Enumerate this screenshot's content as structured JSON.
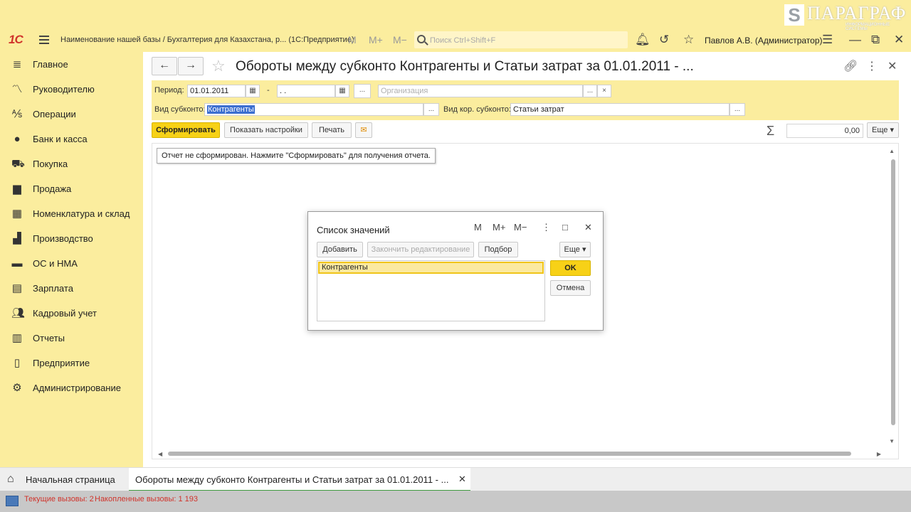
{
  "app": {
    "logo_text": "1С",
    "base_title": "Наименование нашей базы / Бухгалтерия для Казахстана, р...  (1С:Предприятие)",
    "mem_buttons": [
      "M",
      "M+",
      "M−"
    ],
    "search_placeholder": "Поиск Ctrl+Shift+F",
    "user": "Павлов А.В. (Администратор)",
    "brand_name": "ПАРАГРАФ",
    "brand_sub": "ИНФОРМАЦИОННЫЕ СИСТЕМЫ",
    "brand_mark": "S"
  },
  "sidebar": {
    "items": [
      {
        "label": "Главное",
        "icon": "menu-list-icon"
      },
      {
        "label": "Руководителю",
        "icon": "chart-line-icon"
      },
      {
        "label": "Операции",
        "icon": "operations-icon"
      },
      {
        "label": "Банк и касса",
        "icon": "bank-icon"
      },
      {
        "label": "Покупка",
        "icon": "cart-icon"
      },
      {
        "label": "Продажа",
        "icon": "bag-icon"
      },
      {
        "label": "Номенклатура и склад",
        "icon": "grid-icon"
      },
      {
        "label": "Производство",
        "icon": "factory-icon"
      },
      {
        "label": "ОС и НМА",
        "icon": "truck-icon"
      },
      {
        "label": "Зарплата",
        "icon": "wallet-icon"
      },
      {
        "label": "Кадровый учет",
        "icon": "people-icon"
      },
      {
        "label": "Отчеты",
        "icon": "bar-chart-icon"
      },
      {
        "label": "Предприятие",
        "icon": "document-icon"
      },
      {
        "label": "Администрирование",
        "icon": "gear-icon"
      }
    ]
  },
  "report": {
    "title": "Обороты между субконто Контрагенты и Статьи затрат  за 01.01.2011 - ...",
    "period_label": "Период:",
    "period_from": "01.01.2011",
    "period_dash": "-",
    "period_to": " .  .",
    "ellipsis": "...",
    "org_placeholder": "Организация",
    "clear": "×",
    "subconto_label": "Вид субконто:",
    "subconto_value": "Контрагенты",
    "corr_subconto_label": "Вид кор. субконто:",
    "corr_subconto_value": "Статьи затрат",
    "generate": "Сформировать",
    "show_settings": "Показать настройки",
    "print": "Печать",
    "sum_value": "0,00",
    "more": "Еще",
    "notice": "Отчет не сформирован. Нажмите \"Сформировать\" для получения отчета."
  },
  "dialog": {
    "title": "Список значений",
    "tools": [
      "M",
      "M+",
      "M−"
    ],
    "add": "Добавить",
    "finish_edit": "Закончить редактирование",
    "pick": "Подбор",
    "more": "Еще",
    "ok": "OK",
    "cancel": "Отмена",
    "items": [
      "Контрагенты"
    ]
  },
  "tabs": {
    "home": "Начальная страница",
    "active": "Обороты между субконто Контрагенты и Статьи затрат  за 01.01.2011 - ..."
  },
  "status": {
    "current_calls": "Текущие вызовы: 2",
    "accumulated_calls": "Накопленные вызовы: 1 193"
  }
}
